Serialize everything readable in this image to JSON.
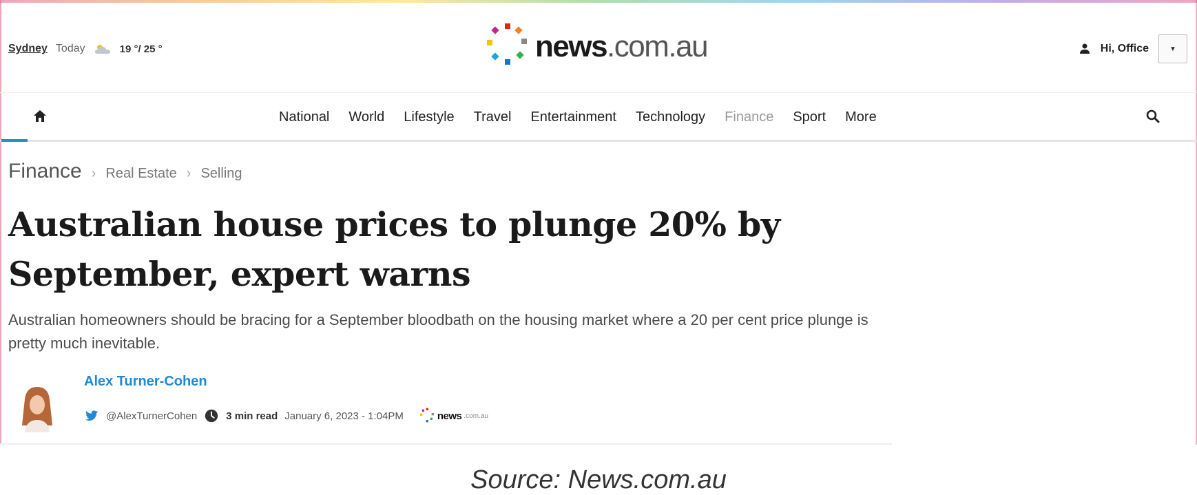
{
  "header": {
    "weather": {
      "city": "Sydney",
      "day": "Today",
      "icon": "partly-cloudy-icon",
      "temps": "19 °/ 25 °"
    },
    "logo": {
      "name": "news",
      "domain": ".com.au"
    },
    "account": {
      "greeting": "Hi, Office",
      "icon": "user-icon"
    }
  },
  "nav": {
    "items": [
      "National",
      "World",
      "Lifestyle",
      "Travel",
      "Entertainment",
      "Technology",
      "Finance",
      "Sport",
      "More"
    ],
    "active": "Finance"
  },
  "breadcrumb": {
    "section": "Finance",
    "sub1": "Real Estate",
    "sub2": "Selling"
  },
  "article": {
    "headline": "Australian house prices to plunge 20% by September, expert warns",
    "standfirst": "Australian homeowners should be bracing for a September bloodbath on the housing market where a 20 per cent price plunge is pretty much inevitable.",
    "author": "Alex Turner-Cohen",
    "twitter": "@AlexTurnerCohen",
    "read_time": "3 min read",
    "date": "January 6, 2023 - 1:04PM",
    "brand_mini": {
      "name": "news",
      "domain": ".com.au"
    }
  },
  "caption": "Source: News.com.au",
  "colors": {
    "link_blue": "#1e8ad6",
    "nav_active": "#9a9a9a",
    "rainbow_accent": "#e85a8a"
  }
}
